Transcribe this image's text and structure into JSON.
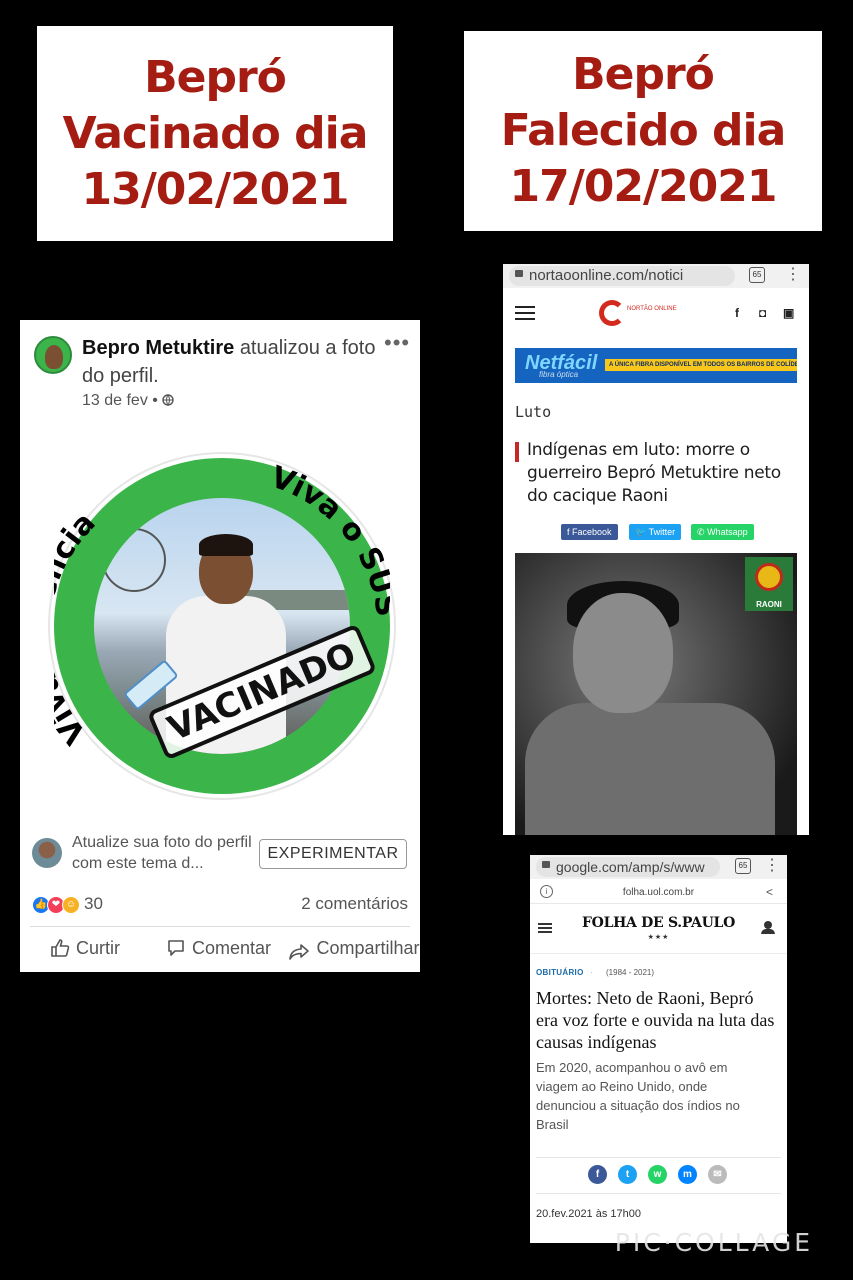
{
  "left_title": {
    "line1": "Bepró",
    "line2": "Vacinado dia",
    "line3": "13/02/2021"
  },
  "right_title": {
    "line1": "Bepró",
    "line2": "Falecido dia",
    "line3": "17/02/2021"
  },
  "facebook_post": {
    "author": "Bepro Metuktire",
    "action": "atualizou a foto do perfil.",
    "date": "13 de fev •",
    "more": "•••",
    "ring_text_left": "Viva a ciência",
    "ring_text_right": "Viva o SUS",
    "stamp": "VACINADO",
    "suggestion_text": "Atualize sua foto do perfil com este tema d...",
    "try_button": "EXPERIMENTAR",
    "reaction_count": "30",
    "comment_count": "2 comentários",
    "actions": {
      "like": "Curtir",
      "comment": "Comentar",
      "share": "Compartilhar"
    }
  },
  "nortao_screen": {
    "url": "nortaoonline.com/notici",
    "tab_count": "65",
    "logo_small_text": "NORTÃO ONLINE",
    "banner_brand": "Netfácil",
    "banner_sub": "fibra óptica",
    "banner_tag": "A ÚNICA FIBRA DISPONÍVEL EM TODOS OS BAIRROS DE COLÍDER!",
    "section": "Luto",
    "headline": "Indígenas em luto: morre o guerreiro Bepró Metuktire neto do cacique Raoni",
    "share_buttons": [
      "f Facebook",
      "Twitter",
      "Whatsapp"
    ],
    "badge_label": "RAONI",
    "colors": {
      "facebook": "#3b5998",
      "twitter": "#1da1f2",
      "whatsapp": "#25d366"
    }
  },
  "folha_screen": {
    "url": "google.com/amp/s/www",
    "tab_count": "65",
    "domain": "folha.uol.com.br",
    "masthead": "FOLHA DE S.PAULO",
    "stars": "★★★",
    "category": "OBITUÁRIO",
    "years": "(1984 - 2021)",
    "headline": "Mortes: Neto de Raoni, Bepró era voz forte e ouvida na luta das causas indígenas",
    "lede": "Em 2020, acompanhou o avô em viagem ao Reino Unido, onde denunciou a situação dos índios no Brasil",
    "date": "20.fev.2021 às 17h00"
  },
  "watermark": "PIC·COLLAGE"
}
